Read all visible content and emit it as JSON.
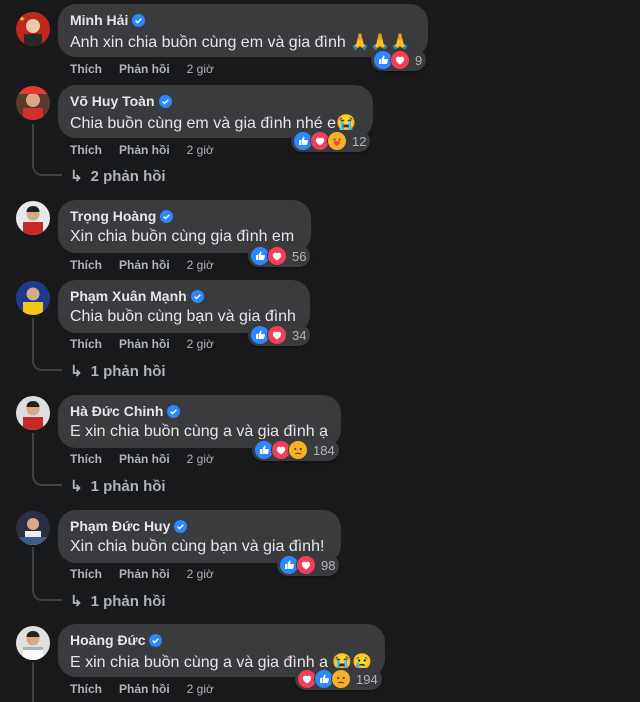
{
  "actions": {
    "like": "Thích",
    "reply": "Phản hồi"
  },
  "comments": [
    {
      "author": "Minh Hải",
      "text": "Anh xin chia buồn cùng em và gia đình",
      "emoji": [
        "🙏",
        "🙏",
        "🙏"
      ],
      "count": "9",
      "time": "2 giờ",
      "replies": ""
    },
    {
      "author": "Võ Huy Toàn",
      "text": "Chia buồn cùng em và gia đình nhé e",
      "emoji": [
        "😭"
      ],
      "count": "12",
      "time": "2 giờ",
      "replies": "2 phản hồi"
    },
    {
      "author": "Trọng Hoàng",
      "text": "Xin chia buồn cùng gia đình em",
      "emoji": [],
      "count": "56",
      "time": "2 giờ",
      "replies": ""
    },
    {
      "author": "Phạm Xuân Mạnh",
      "text": "Chia buồn cùng bạn và gia đình",
      "emoji": [],
      "count": "34",
      "time": "2 giờ",
      "replies": "1 phản hồi"
    },
    {
      "author": "Hà Đức Chinh",
      "text": "E xin chia buồn cùng a và gia đình ạ",
      "emoji": [],
      "count": "184",
      "time": "2 giờ",
      "replies": "1 phản hồi"
    },
    {
      "author": "Phạm Đức Huy",
      "text": "Xin chia buồn cùng bạn và gia đình!",
      "emoji": [],
      "count": "98",
      "time": "2 giờ",
      "replies": "1 phản hồi"
    },
    {
      "author": "Hoàng Đức",
      "text": "E xin chia buồn cùng a và gia đình ạ",
      "emoji": [
        "😭",
        "😢"
      ],
      "count": "194",
      "time": "2 giờ",
      "replies": ""
    }
  ],
  "reaction_icons": [
    [
      "like-icon",
      "love-icon"
    ],
    [
      "like-icon",
      "love-icon",
      "care-icon"
    ],
    [
      "like-icon",
      "love-icon"
    ],
    [
      "like-icon",
      "love-icon"
    ],
    [
      "like-icon",
      "love-icon",
      "sad-icon"
    ],
    [
      "like-icon",
      "love-icon"
    ],
    [
      "love-icon",
      "like-icon",
      "sad-icon"
    ]
  ],
  "colors": {
    "background": "#18191a",
    "bubble": "#3a3b3c",
    "like": "#2d88ff",
    "love": "#f33e58",
    "haha": "#f7b125",
    "verified": "#2d88ff"
  }
}
